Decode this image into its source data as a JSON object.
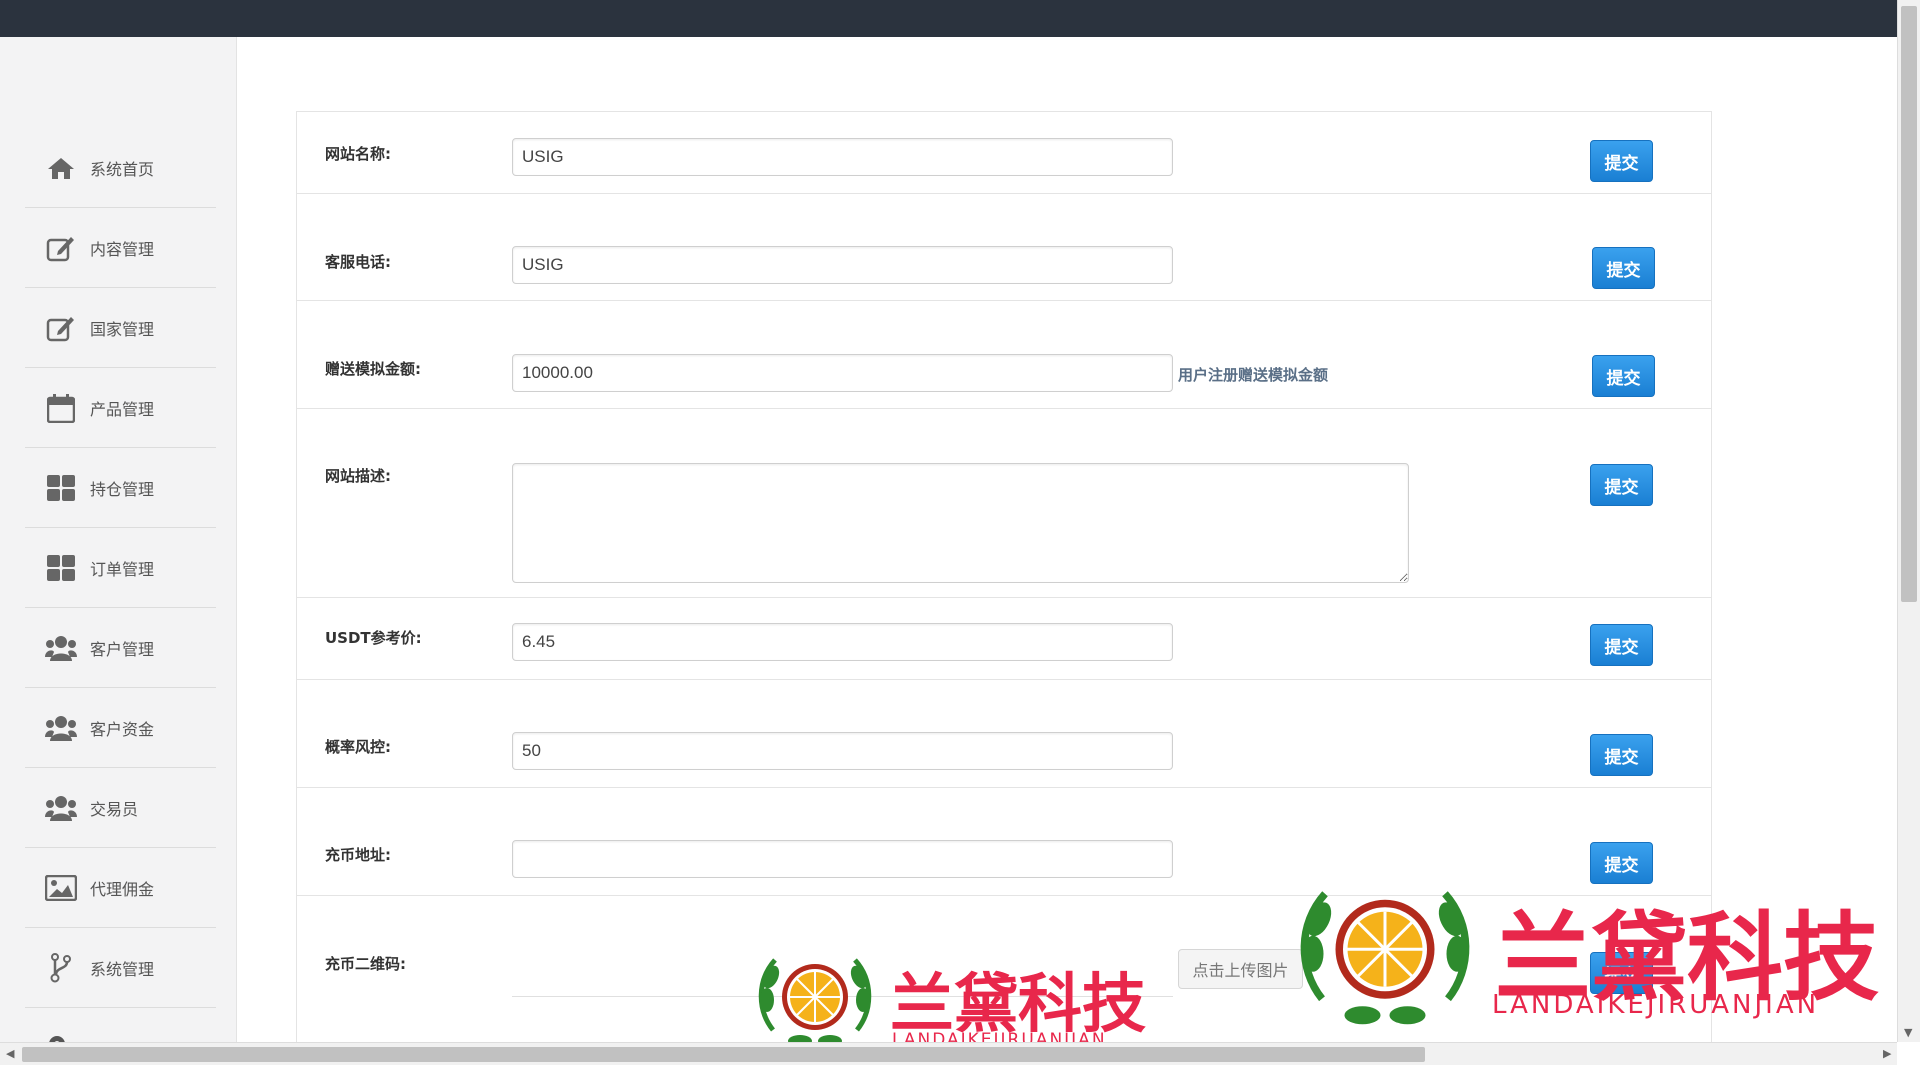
{
  "sidebar": {
    "items": [
      {
        "label": "系统首页",
        "icon": "home-icon"
      },
      {
        "label": "内容管理",
        "icon": "edit-icon"
      },
      {
        "label": "国家管理",
        "icon": "edit-icon"
      },
      {
        "label": "产品管理",
        "icon": "calendar-icon"
      },
      {
        "label": "持仓管理",
        "icon": "grid-icon"
      },
      {
        "label": "订单管理",
        "icon": "grid-icon"
      },
      {
        "label": "客户管理",
        "icon": "users-icon"
      },
      {
        "label": "客户资金",
        "icon": "users-icon"
      },
      {
        "label": "交易员",
        "icon": "users-icon"
      },
      {
        "label": "代理佣金",
        "icon": "image-icon"
      },
      {
        "label": "系统管理",
        "icon": "branch-icon"
      }
    ]
  },
  "form": {
    "submit_label": "提交",
    "rows": [
      {
        "label": "网站名称:",
        "value": "USIG"
      },
      {
        "label": "客服电话:",
        "value": "USIG"
      },
      {
        "label": "赠送模拟金额:",
        "value": "10000.00",
        "hint": "用户注册赠送模拟金额"
      },
      {
        "label": "网站描述:",
        "value": ""
      },
      {
        "label": "USDT参考价:",
        "value": "6.45"
      },
      {
        "label": "概率风控:",
        "value": "50"
      },
      {
        "label": "充币地址:",
        "value": ""
      },
      {
        "label": "充币二维码:",
        "upload_label": "点击上传图片"
      }
    ]
  },
  "watermark": {
    "brand": "兰黛科技",
    "sub": "LANDAIKEJIRUANJIAN"
  },
  "colors": {
    "topbar": "#2b333e",
    "sidebar_bg": "#f3f3f4",
    "button": "#1a7fd3",
    "watermark": "#e8274b"
  }
}
